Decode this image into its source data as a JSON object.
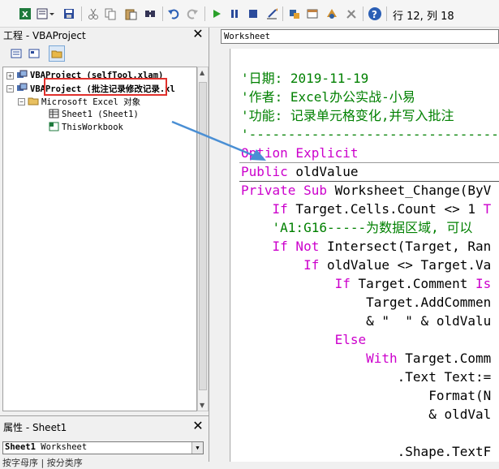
{
  "toolbar": {
    "status": "行 12, 列 18",
    "icons": [
      "excel-icon",
      "insert-module-icon",
      "save-icon",
      "cut-icon",
      "copy-icon",
      "paste-icon",
      "find-icon",
      "undo-icon",
      "redo-icon",
      "run-icon",
      "break-icon",
      "reset-icon",
      "design-mode-icon",
      "project-explorer-icon",
      "properties-icon",
      "object-browser-icon",
      "toolbox-icon",
      "help-icon"
    ]
  },
  "project_pane": {
    "title": "工程 - VBAProject",
    "close": "✕",
    "tree": [
      {
        "label": "VBAProject (selfTool.xlam)",
        "expander": "+",
        "bold": true
      },
      {
        "label": "VBAProject (批注记录修改记录.xl",
        "expander": "−",
        "bold": true
      },
      {
        "label": "Microsoft Excel 对象",
        "expander": "−",
        "bold": false
      },
      {
        "label": "Sheet1 (Sheet1)",
        "expander": "",
        "bold": false
      },
      {
        "label": "ThisWorkbook",
        "expander": "",
        "bold": false
      }
    ]
  },
  "properties_pane": {
    "title": "属性 - Sheet1",
    "close": "✕",
    "object_name": "Sheet1",
    "object_type": "Worksheet",
    "tab_label": "按字母序 | 按分类序"
  },
  "code_window": {
    "object_dropdown": "Worksheet",
    "lines": [
      [
        {
          "t": "'日期: 2019-11-19",
          "c": "comment"
        }
      ],
      [
        {
          "t": "'作者: Excel办公实战-小易",
          "c": "comment"
        }
      ],
      [
        {
          "t": "'功能: 记录单元格变化,并写入批注",
          "c": "comment"
        }
      ],
      [
        {
          "t": "'---------------------------------------------",
          "c": "comment"
        }
      ],
      [
        {
          "t": "Option Explicit",
          "c": "kw"
        }
      ],
      [
        {
          "t": "Public",
          "c": "kw"
        },
        {
          "t": " oldValue",
          "c": "code"
        }
      ],
      [
        {
          "t": "Private Sub",
          "c": "kw"
        },
        {
          "t": " Worksheet_Change(ByV",
          "c": "code"
        }
      ],
      [
        {
          "t": "    If",
          "c": "kw"
        },
        {
          "t": " Target.Cells.Count <> 1 ",
          "c": "code"
        },
        {
          "t": "T",
          "c": "kw"
        }
      ],
      [
        {
          "t": "    'A1:G16-----为数据区域, 可以",
          "c": "comment"
        }
      ],
      [
        {
          "t": "    If Not",
          "c": "kw"
        },
        {
          "t": " Intersect(Target, Ran",
          "c": "code"
        }
      ],
      [
        {
          "t": "        If",
          "c": "kw"
        },
        {
          "t": " oldValue <> Target.Va",
          "c": "code"
        }
      ],
      [
        {
          "t": "            If",
          "c": "kw"
        },
        {
          "t": " Target.Comment ",
          "c": "code"
        },
        {
          "t": "Is",
          "c": "kw"
        }
      ],
      [
        {
          "t": "                Target.AddCommen",
          "c": "code"
        }
      ],
      [
        {
          "t": "                & \"  \" & oldValu",
          "c": "code"
        }
      ],
      [
        {
          "t": "            Else",
          "c": "kw"
        }
      ],
      [
        {
          "t": "                With",
          "c": "kw"
        },
        {
          "t": " Target.Comm",
          "c": "code"
        }
      ],
      [
        {
          "t": "                    .Text Text:=",
          "c": "code"
        }
      ],
      [
        {
          "t": "                        Format(N",
          "c": "code"
        }
      ],
      [
        {
          "t": "                        & oldVal",
          "c": "code"
        }
      ],
      [
        {
          "t": "",
          "c": "code"
        }
      ],
      [
        {
          "t": "                    .Shape.TextF",
          "c": "code"
        }
      ]
    ]
  },
  "colors": {
    "comment": "#008000",
    "keyword": "#cc00cc",
    "highlight_box": "#e0302c",
    "arrow": "#4a8fd4"
  }
}
